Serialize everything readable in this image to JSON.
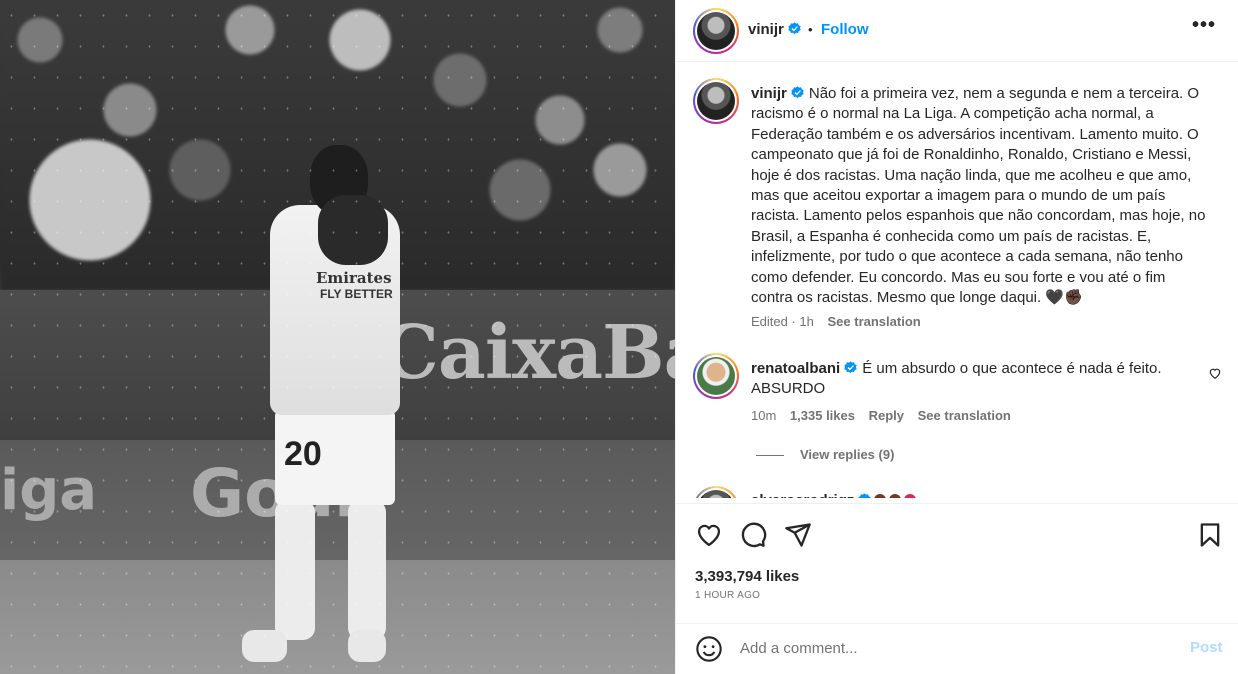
{
  "photo": {
    "board_text": "CaixaBank",
    "board2_text": "Goal",
    "board2_left_text": "iga",
    "sponsor_text": "Emirates",
    "sponsor_text2": "FLY BETTER",
    "jersey_number": "20"
  },
  "header": {
    "username": "vinijr",
    "separator": "•",
    "follow_label": "Follow",
    "more_label": "•••"
  },
  "caption": {
    "username": "vinijr",
    "text": "Não foi a primeira vez, nem a segunda e nem a terceira. O racismo é o normal na La Liga. A competição acha normal, a Federação também e os adversários incentivam. Lamento muito. O campeonato que já foi de Ronaldinho, Ronaldo, Cristiano e Messi, hoje é dos racistas. Uma nação linda, que me acolheu e que amo, mas que aceitou exportar a imagem para o mundo de um país racista. Lamento pelos espanhois que não concordam, mas hoje, no Brasil, a Espanha é conhecida como um país de racistas. E, infelizmente, por tudo o que acontece a cada semana, não tenho como defender. Eu concordo. Mas eu sou forte e vou até o fim contra os racistas. Mesmo que longe daqui. 🖤✊🏿",
    "edited": "Edited · 1h",
    "see_translation": "See translation"
  },
  "comment": {
    "username": "renatoalbani",
    "text": "É um absurdo o que acontece é nada é feito. ABSURDO",
    "time": "10m",
    "likes": "1,335 likes",
    "reply": "Reply",
    "see_translation": "See translation",
    "view_replies": "View replies (9)"
  },
  "partial_comment": {
    "username": "alvaroarodrigz"
  },
  "post_stats": {
    "likes": "3,393,794 likes",
    "time_ago": "1 HOUR AGO"
  },
  "add_comment": {
    "placeholder": "Add a comment...",
    "post_label": "Post"
  },
  "icons": {
    "verified": "verified-badge-icon",
    "heart": "heart-icon",
    "comment": "comment-icon",
    "share": "share-icon",
    "save": "bookmark-icon",
    "emoji": "emoji-icon"
  },
  "colors": {
    "link_blue": "#0095f6",
    "post_disabled": "#b3dbff",
    "text_primary": "#262626",
    "text_secondary": "#737373"
  }
}
